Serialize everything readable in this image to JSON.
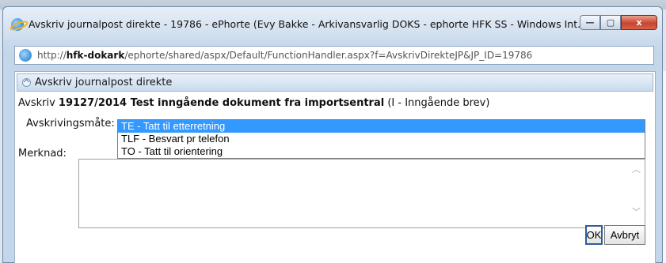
{
  "window": {
    "title": "Avskriv journalpost direkte - 19786 - ePhorte (Evy Bakke - Arkivansvarlig DOKS - ephorte HFK SS - Windows Int...",
    "minimize_glyph": "—",
    "maximize_glyph": "▢",
    "close_glyph": "x"
  },
  "address": {
    "prefix": "http://",
    "host": "hfk-dokark",
    "path": "/ephorte/shared/aspx/Default/FunctionHandler.aspx?f=AvskrivDirekteJP&JP_ID=19786"
  },
  "panel": {
    "title": "Avskriv journalpost direkte"
  },
  "subject": {
    "prefix": "Avskriv ",
    "bold": "19127/2014 Test inngående dokument fra importsentral",
    "suffix": " (I - Inngående brev)"
  },
  "form": {
    "avskrivingsmate_label": "Avskrivingsmåte:",
    "merknad_label": "Merknad:",
    "options": [
      "TE - Tatt til etterretning",
      "TLF - Besvart pr telefon",
      "TO - Tatt til orientering"
    ],
    "selected_index": 0,
    "merknad_value": ""
  },
  "buttons": {
    "ok": "OK",
    "cancel": "Avbryt"
  },
  "icons": {
    "app": "ie-icon",
    "panel": "collapse-icon",
    "scroll_up": "chevron-up-icon",
    "scroll_down": "chevron-down-icon"
  }
}
